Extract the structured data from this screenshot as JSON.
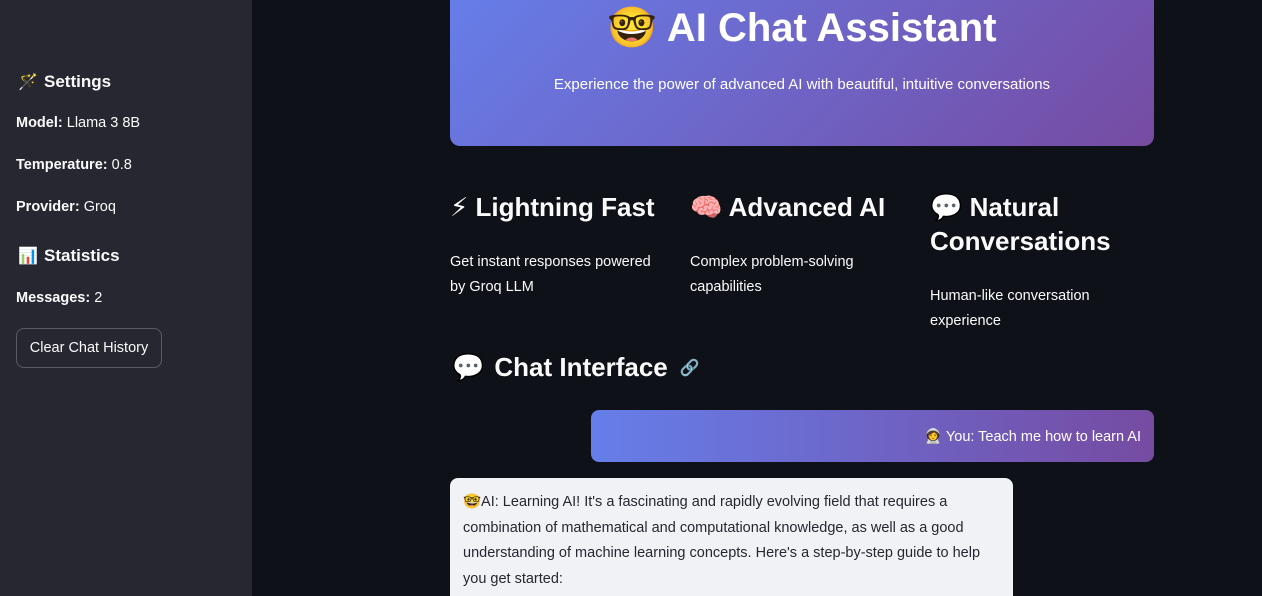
{
  "sidebar": {
    "settings_icon": "🪄",
    "settings_heading": "Settings",
    "model_label": "Model:",
    "model_value": "Llama 3 8B",
    "temperature_label": "Temperature:",
    "temperature_value": "0.8",
    "provider_label": "Provider:",
    "provider_value": "Groq",
    "stats_icon": "📊",
    "stats_heading": "Statistics",
    "messages_label": "Messages:",
    "messages_value": "2",
    "clear_button": "Clear Chat History"
  },
  "hero": {
    "icon": "🤓",
    "title": "AI Chat Assistant",
    "subtitle": "Experience the power of advanced AI with beautiful, intuitive conversations"
  },
  "features": [
    {
      "icon": "⚡",
      "title": "Lightning Fast",
      "desc": "Get instant responses powered by Groq LLM"
    },
    {
      "icon": "🧠",
      "title": "Advanced AI",
      "desc": "Complex problem-solving capabilities"
    },
    {
      "icon": "💬",
      "title": "Natural Conversations",
      "desc": "Human-like conversation experience"
    }
  ],
  "chat": {
    "header_icon": "💬",
    "header": "Chat Interface",
    "anchor_icon": "🔗",
    "user_message": "🧑‍🚀 You: Teach me how to learn AI",
    "ai_message": "🤓AI: Learning AI! It's a fascinating and rapidly evolving field that requires a combination of mathematical and computational knowledge, as well as a good understanding of machine learning concepts. Here's a step-by-step guide to help you get started:"
  },
  "colors": {
    "sidebar_bg": "#262730",
    "main_bg": "#0e1117",
    "gradient_start": "#667eea",
    "gradient_end": "#764ba2",
    "ai_bubble_bg": "#f0f2f6"
  }
}
